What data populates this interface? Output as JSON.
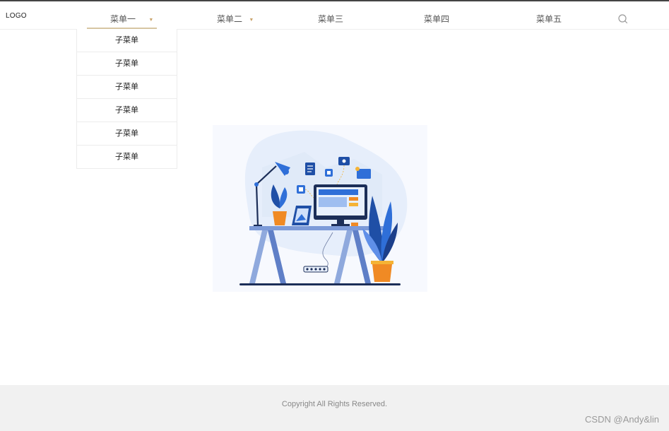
{
  "header": {
    "logo": "LOGO",
    "nav": [
      {
        "label": "菜单一",
        "has_dropdown": true,
        "active": true
      },
      {
        "label": "菜单二",
        "has_dropdown": true,
        "active": false
      },
      {
        "label": "菜单三",
        "has_dropdown": false,
        "active": false
      },
      {
        "label": "菜单四",
        "has_dropdown": false,
        "active": false
      },
      {
        "label": "菜单五",
        "has_dropdown": false,
        "active": false
      }
    ],
    "caret": "▼",
    "search_icon": "search-icon"
  },
  "dropdown": {
    "items": [
      "子菜单",
      "子菜单",
      "子菜单",
      "子菜单",
      "子菜单",
      "子菜单"
    ]
  },
  "footer": {
    "copyright": "Copyright All Rights Reserved."
  },
  "watermark": "CSDN @Andy&lin",
  "colors": {
    "accent_underline": "#d7c6a2",
    "caret": "#c9a36a",
    "footer_bg": "#f1f1f1",
    "illustration_blue": "#2f6fd8",
    "illustration_orange": "#f08a24"
  }
}
